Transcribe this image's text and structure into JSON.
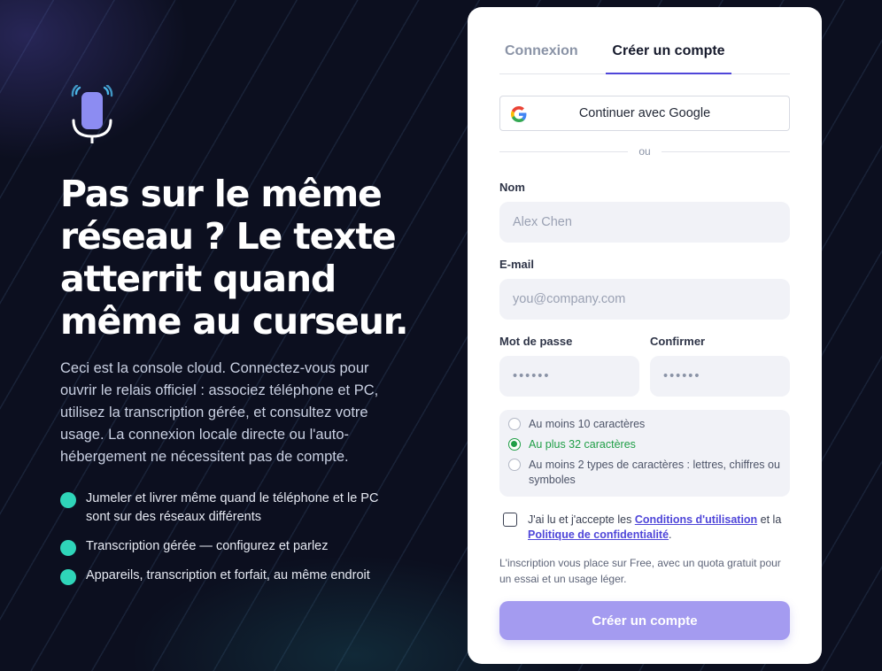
{
  "hero": {
    "title": "Pas sur le même réseau ? Le texte atterrit quand même au curseur.",
    "description": "Ceci est la console cloud. Connectez-vous pour ouvrir le relais officiel : associez téléphone et PC, utilisez la transcription gérée, et consultez votre usage. La connexion locale directe ou l'auto-hébergement ne nécessitent pas de compte.",
    "features": [
      "Jumeler et livrer même quand le téléphone et le PC sont sur des réseaux différents",
      "Transcription gérée — configurez et parlez",
      "Appareils, transcription et forfait, au même endroit"
    ]
  },
  "tabs": {
    "login": "Connexion",
    "signup": "Créer un compte"
  },
  "google": {
    "label": "Continuer avec Google",
    "icon": "google-icon"
  },
  "divider": "ou",
  "form": {
    "name_label": "Nom",
    "name_placeholder": "Alex Chen",
    "email_label": "E-mail",
    "email_placeholder": "you@company.com",
    "password_label": "Mot de passe",
    "password_placeholder": "••••••",
    "confirm_label": "Confirmer",
    "confirm_placeholder": "••••••"
  },
  "rules": [
    {
      "text": "Au moins 10 caractères",
      "ok": false
    },
    {
      "text": "Au plus 32 caractères",
      "ok": true
    },
    {
      "text": "Au moins 2 types de caractères : lettres, chiffres ou symboles",
      "ok": false
    }
  ],
  "consent": {
    "before": "J'ai lu et j'accepte les ",
    "terms": "Conditions d'utilisation",
    "middle": " et la ",
    "privacy": "Politique de confidentialité",
    "after": "."
  },
  "note": "L'inscription vous place sur Free, avec un quota gratuit pour un essai et un usage léger.",
  "submit_label": "Créer un compte",
  "colors": {
    "accent": "#4f46d9",
    "success": "#1f9e46",
    "feature_bullet": "#2fd5b9",
    "submit_bg": "#a49bf0"
  }
}
